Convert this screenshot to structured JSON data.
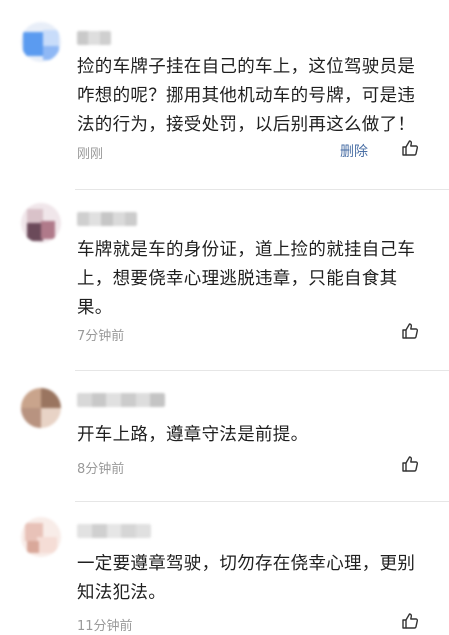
{
  "comments": [
    {
      "text": "捡的车牌子挂在自己的车上，这位驾驶员是咋想的呢？挪用其他机动车的号牌，可是违法的行为，接受处罚，以后别再这么做了！",
      "lines": [
        "捡的车牌子挂在自己的车上，这位驾驶员是",
        "咋想的呢？挪用其他机动车的号牌，可是违",
        "法的行为，接受处罚，以后别再这么做了！"
      ],
      "time": "刚刚",
      "delete_label": "删除",
      "avatar_colors": [
        "#5b9bf0",
        "#8fb8f5",
        "#c8dcfa",
        "#e8eef8"
      ],
      "like_icon": "thumbs-up-icon"
    },
    {
      "text": "车牌就是车的身份证，道上捡的就挂自己车上，想要侥幸心理逃脱违章，只能自食其果。",
      "lines": [
        "车牌就是车的身份证，道上捡的就挂自己车",
        "上，想要侥幸心理逃脱违章，只能自食其",
        "果。"
      ],
      "time": "7分钟前",
      "avatar_colors": [
        "#b07a8a",
        "#6b4a5a",
        "#d9c2c9",
        "#f0e6ea"
      ],
      "like_icon": "thumbs-up-icon"
    },
    {
      "text": "开车上路，遵章守法是前提。",
      "lines": [
        "开车上路，遵章守法是前提。"
      ],
      "time": "8分钟前",
      "avatar_colors": [
        "#c9a48c",
        "#9a7560",
        "#e8d3c6",
        "#b89380"
      ],
      "like_icon": "thumbs-up-icon"
    },
    {
      "text": "一定要遵章驾驶，切勿存在侥幸心理，更别知法犯法。",
      "lines": [
        "一定要遵章驾驶，切勿存在侥幸心理，更别",
        "知法犯法。"
      ],
      "time": "11分钟前",
      "avatar_colors": [
        "#e8c2b8",
        "#f5ddd6",
        "#d9a89a",
        "#f8ece8"
      ],
      "like_icon": "thumbs-up-icon"
    }
  ],
  "colors": {
    "text": "#1f1f1f",
    "time": "#9a9a9a",
    "delete": "#4a6fa5",
    "divider": "#e6e6e6"
  }
}
